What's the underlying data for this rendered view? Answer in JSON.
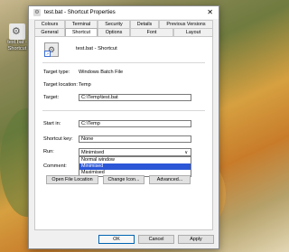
{
  "desktop": {
    "icon_label": "test.bat - Shortcut"
  },
  "window": {
    "title": "test.bat - Shortcut Properties",
    "close_glyph": "✕"
  },
  "tabs": {
    "row1": [
      "Colours",
      "Terminal",
      "Security",
      "Details",
      "Previous Versions"
    ],
    "row2": [
      "General",
      "Shortcut",
      "Options",
      "Font",
      "Layout"
    ],
    "active": "Shortcut"
  },
  "shortcut": {
    "name": "test.bat - Shortcut",
    "target_type_label": "Target type:",
    "target_type_value": "Windows Batch File",
    "target_location_label": "Target location:",
    "target_location_value": "Temp",
    "target_label": "Target:",
    "target_value": "C:\\Temp\\test.bat",
    "start_in_label": "Start in:",
    "start_in_value": "C:\\Temp",
    "shortcut_key_label": "Shortcut key:",
    "shortcut_key_value": "None",
    "run_label": "Run:",
    "run_value": "Minimised",
    "run_options": [
      "Normal window",
      "Minimised",
      "Maximised"
    ],
    "comment_label": "Comment:"
  },
  "buttons": {
    "open_file_location": "Open File Location",
    "change_icon": "Change Icon...",
    "advanced": "Advanced...",
    "ok": "OK",
    "cancel": "Cancel",
    "apply": "Apply"
  }
}
